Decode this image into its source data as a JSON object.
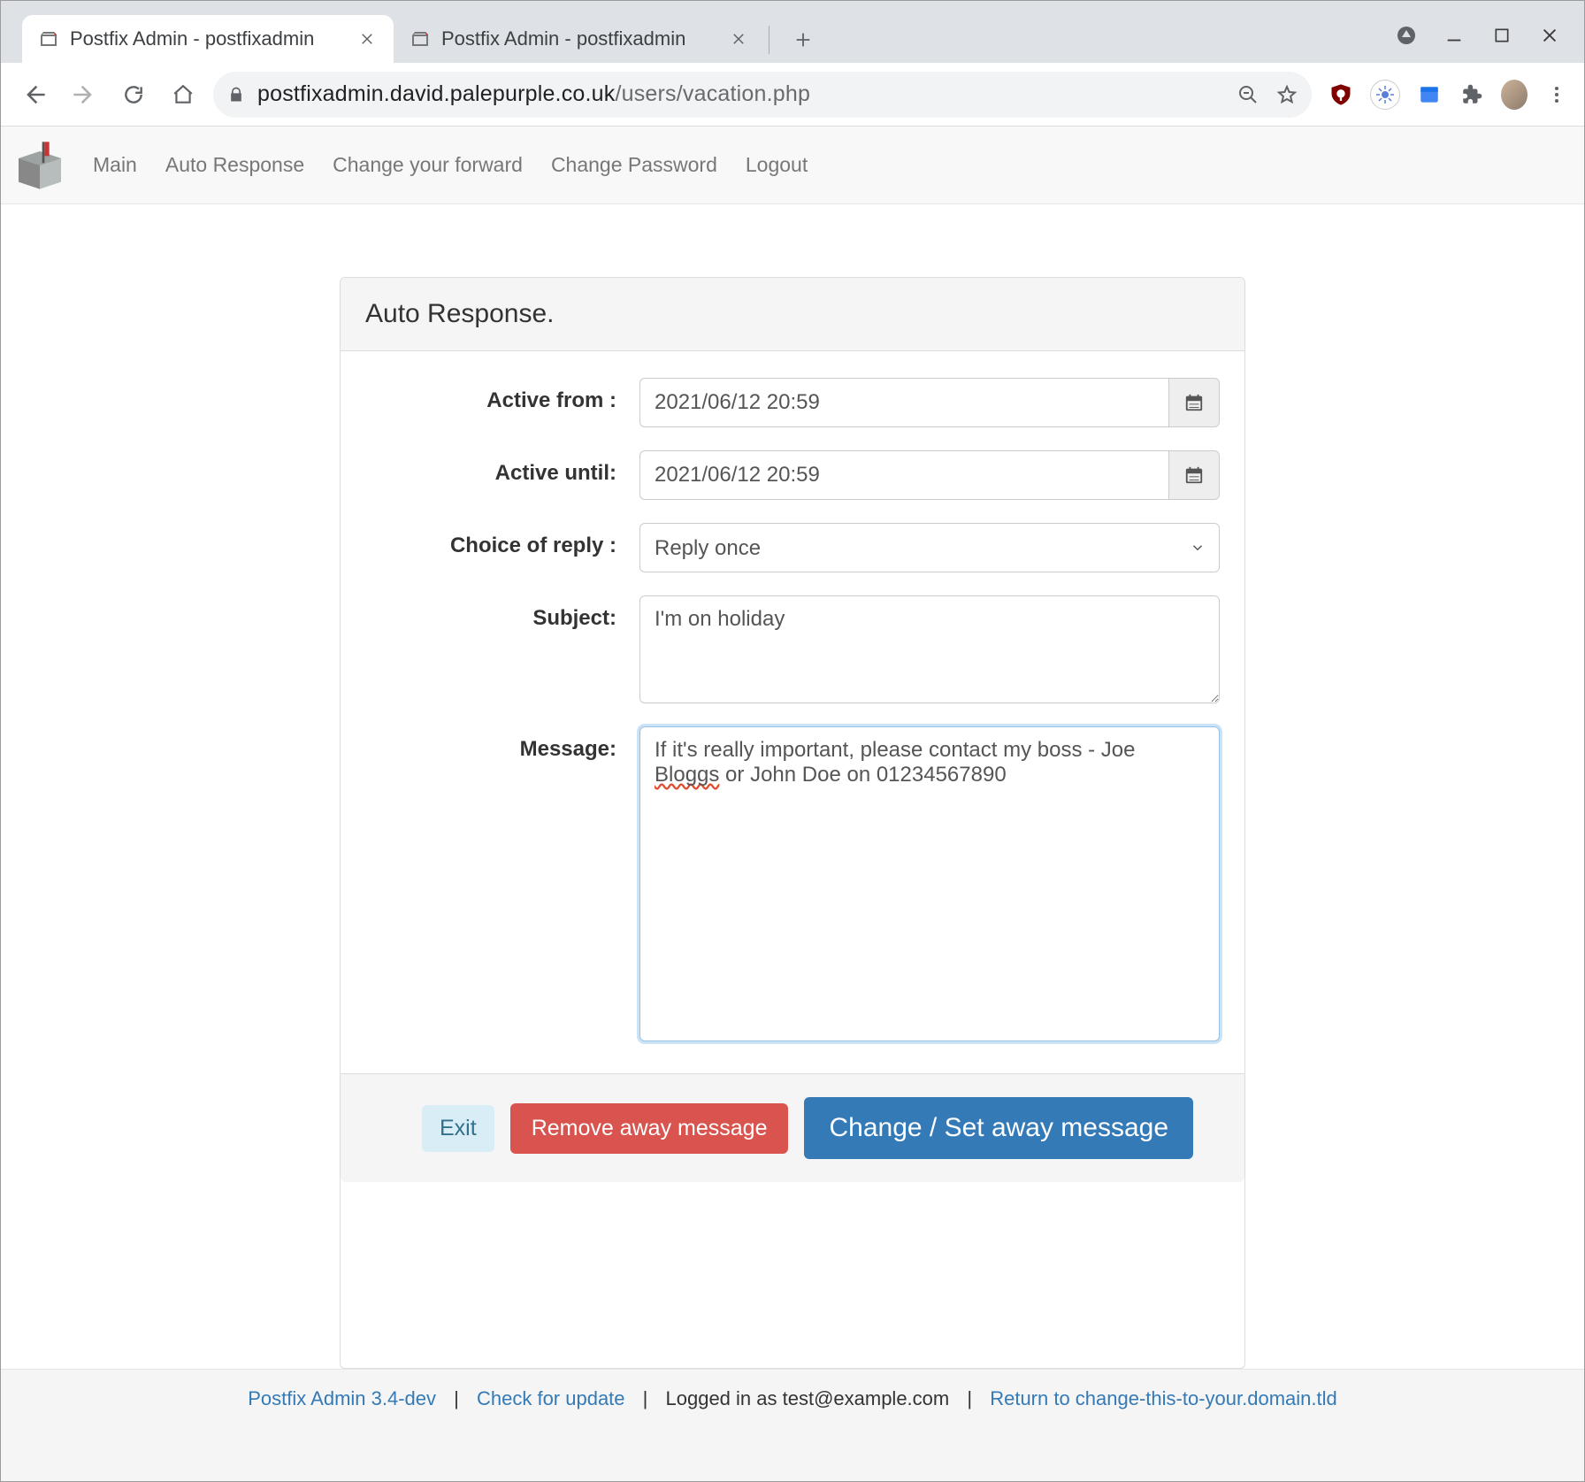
{
  "browser": {
    "tabs": [
      {
        "title": "Postfix Admin - postfixadmin"
      },
      {
        "title": "Postfix Admin - postfixadmin"
      }
    ],
    "url_host": "postfixadmin.david.palepurple.co.uk",
    "url_path": "/users/vacation.php"
  },
  "nav": {
    "items": [
      "Main",
      "Auto Response",
      "Change your forward",
      "Change Password",
      "Logout"
    ]
  },
  "panel": {
    "title": "Auto Response."
  },
  "form": {
    "active_from": {
      "label": "Active from :",
      "value": "2021/06/12 20:59"
    },
    "active_until": {
      "label": "Active until:",
      "value": "2021/06/12 20:59"
    },
    "choice_of_reply": {
      "label": "Choice of reply :",
      "selected": "Reply once"
    },
    "subject": {
      "label": "Subject:",
      "value": "I'm on holiday"
    },
    "message": {
      "label": "Message:",
      "prefix": "If it's really important, please contact my boss - Joe ",
      "spell_word": "Bloggs",
      "suffix": " or John Doe on 01234567890"
    }
  },
  "buttons": {
    "exit": "Exit",
    "remove": "Remove away message",
    "submit": "Change / Set away message"
  },
  "footer": {
    "version": "Postfix Admin 3.4-dev",
    "check_update": "Check for update",
    "logged_in": "Logged in as test@example.com",
    "return_link": "Return to change-this-to-your.domain.tld"
  }
}
